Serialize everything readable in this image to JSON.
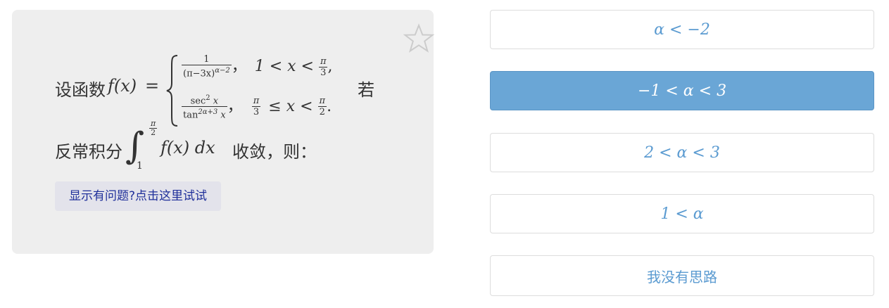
{
  "question": {
    "prefix": "设函数",
    "fx": "f(x)",
    "equals": "=",
    "case1_num": "1",
    "case1_den": "(π−3x)",
    "case1_den_exp": "α−2",
    "case1_comma": "，",
    "case1_cond": "1 < x <",
    "case1_bound_num": "π",
    "case1_bound_den": "3",
    "case1_tail": ",",
    "case2_num": "sec",
    "case2_num_exp": "2",
    "case2_num_var": "x",
    "case2_den": "tan",
    "case2_den_exp": "2α+3",
    "case2_den_var": "x",
    "case2_comma": "，",
    "case2_lower_num": "π",
    "case2_lower_den": "3",
    "case2_cond": "≤ x <",
    "case2_upper_num": "π",
    "case2_upper_den": "2",
    "case2_tail": ".",
    "ruo": "若",
    "line2_prefix": "反常积分",
    "integral_sign": "∫",
    "integral_upper_num": "π",
    "integral_upper_den": "2",
    "integral_lower": "1",
    "integrand": "f(x) dx",
    "line2_suffix": "收敛，则："
  },
  "help_button": "显示有问题?点击这里试试",
  "star_icon": "star-outline-icon",
  "options": [
    {
      "label": "α < −2",
      "selected": false
    },
    {
      "label": "−1 < α < 3",
      "selected": true
    },
    {
      "label": "2 < α < 3",
      "selected": false
    },
    {
      "label": "1 < α",
      "selected": false
    },
    {
      "label": "我没有思路",
      "selected": false
    }
  ],
  "colors": {
    "card_bg": "#eeeeee",
    "option_text": "#5b9bd1",
    "option_selected_bg": "#6aa6d6",
    "help_text": "#1f2f9a"
  }
}
